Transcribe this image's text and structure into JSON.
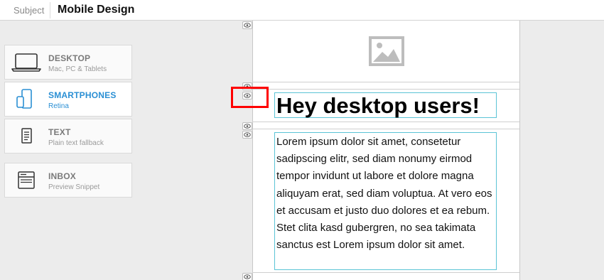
{
  "topbar": {
    "subject_label": "Subject",
    "subject_value": "Mobile Design"
  },
  "devices": [
    {
      "title": "DESKTOP",
      "subtitle": "Mac, PC & Tablets",
      "icon": "laptop-icon",
      "selected": false
    },
    {
      "title": "SMARTPHONES",
      "subtitle": "Retina",
      "icon": "smartphone-icon",
      "selected": true
    },
    {
      "title": "TEXT",
      "subtitle": "Plain text fallback",
      "icon": "text-document-icon",
      "selected": false
    },
    {
      "title": "INBOX",
      "subtitle": "Preview Snippet",
      "icon": "inbox-icon",
      "selected": false
    }
  ],
  "content": {
    "heading": "Hey desktop users!",
    "body": "Lorem ipsum dolor sit amet, consetetur sadipscing elitr, sed diam nonumy eirmod tempor invidunt ut labore et dolore magna aliquyam erat, sed diam voluptua. At vero eos et accusam et justo duo dolores et ea rebum. Stet clita kasd gubergren, no sea takimata sanctus est Lorem ipsum dolor sit amet."
  },
  "colors": {
    "accent": "#2a8fd4",
    "selection_border": "#5bc4d6",
    "highlight": "#ff0000"
  }
}
